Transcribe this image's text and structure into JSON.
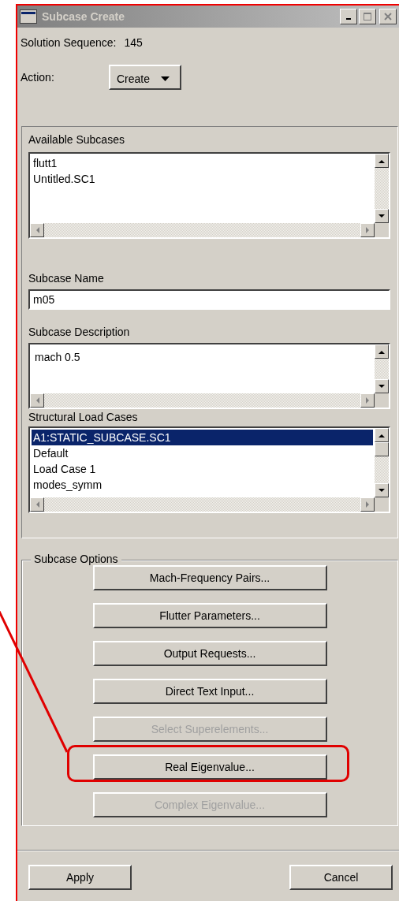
{
  "window": {
    "title": "Subcase Create"
  },
  "solution_sequence": {
    "label": "Solution Sequence:",
    "value": "145"
  },
  "action": {
    "label": "Action:",
    "value": "Create"
  },
  "available_subcases": {
    "label": "Available Subcases",
    "items": [
      {
        "text": "flutt1",
        "selected": false
      },
      {
        "text": "Untitled.SC1",
        "selected": false
      }
    ]
  },
  "subcase_name": {
    "label": "Subcase Name",
    "value": "m05"
  },
  "subcase_description": {
    "label": "Subcase Description",
    "value": "mach 0.5"
  },
  "structural_load_cases": {
    "label": "Structural Load Cases",
    "items": [
      {
        "text": "A1:STATIC_SUBCASE.SC1",
        "selected": true
      },
      {
        "text": "Default",
        "selected": false
      },
      {
        "text": "Load Case 1",
        "selected": false
      },
      {
        "text": "modes_symm",
        "selected": false
      }
    ]
  },
  "subcase_options": {
    "label": "Subcase Options",
    "buttons": [
      {
        "label": "Mach-Frequency Pairs...",
        "disabled": false,
        "highlighted": false
      },
      {
        "label": "Flutter Parameters...",
        "disabled": false,
        "highlighted": false
      },
      {
        "label": "Output Requests...",
        "disabled": false,
        "highlighted": false
      },
      {
        "label": "Direct Text Input...",
        "disabled": false,
        "highlighted": false
      },
      {
        "label": "Select Superelements...",
        "disabled": true,
        "highlighted": false
      },
      {
        "label": "Real Eigenvalue...",
        "disabled": false,
        "highlighted": true
      },
      {
        "label": "Complex Eigenvalue...",
        "disabled": true,
        "highlighted": false
      }
    ]
  },
  "buttons": [
    "Apply",
    "Cancel"
  ]
}
